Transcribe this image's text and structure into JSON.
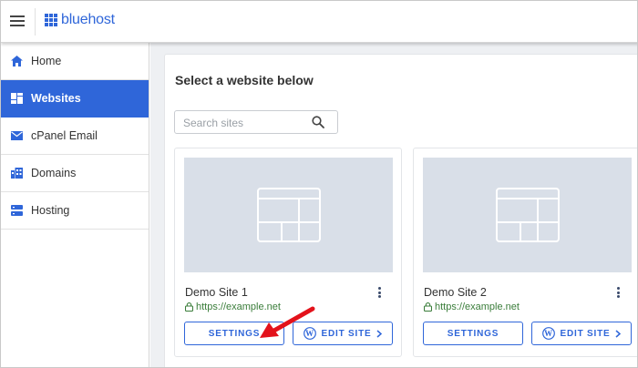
{
  "header": {
    "brand": "bluehost",
    "menu_icon": "hamburger-menu-icon",
    "brand_color": "#2f66d9"
  },
  "sidebar": {
    "items": [
      {
        "label": "Home",
        "icon": "home-icon",
        "active": false
      },
      {
        "label": "Websites",
        "icon": "websites-grid-icon",
        "active": true
      },
      {
        "label": "cPanel Email",
        "icon": "envelope-icon",
        "active": false
      },
      {
        "label": "Domains",
        "icon": "domains-building-icon",
        "active": false
      },
      {
        "label": "Hosting",
        "icon": "hosting-server-icon",
        "active": false
      }
    ],
    "active_color": "#2f66d9"
  },
  "main": {
    "title": "Select a website below",
    "search": {
      "placeholder": "Search sites",
      "value": ""
    },
    "sites": [
      {
        "name": "Demo Site 1",
        "url": "https://example.net",
        "settings_label": "SETTINGS",
        "edit_label": "EDIT SITE"
      },
      {
        "name": "Demo Site 2",
        "url": "https://example.net",
        "settings_label": "SETTINGS",
        "edit_label": "EDIT SITE"
      }
    ]
  },
  "annotation": {
    "arrow_color": "#e3121b"
  }
}
